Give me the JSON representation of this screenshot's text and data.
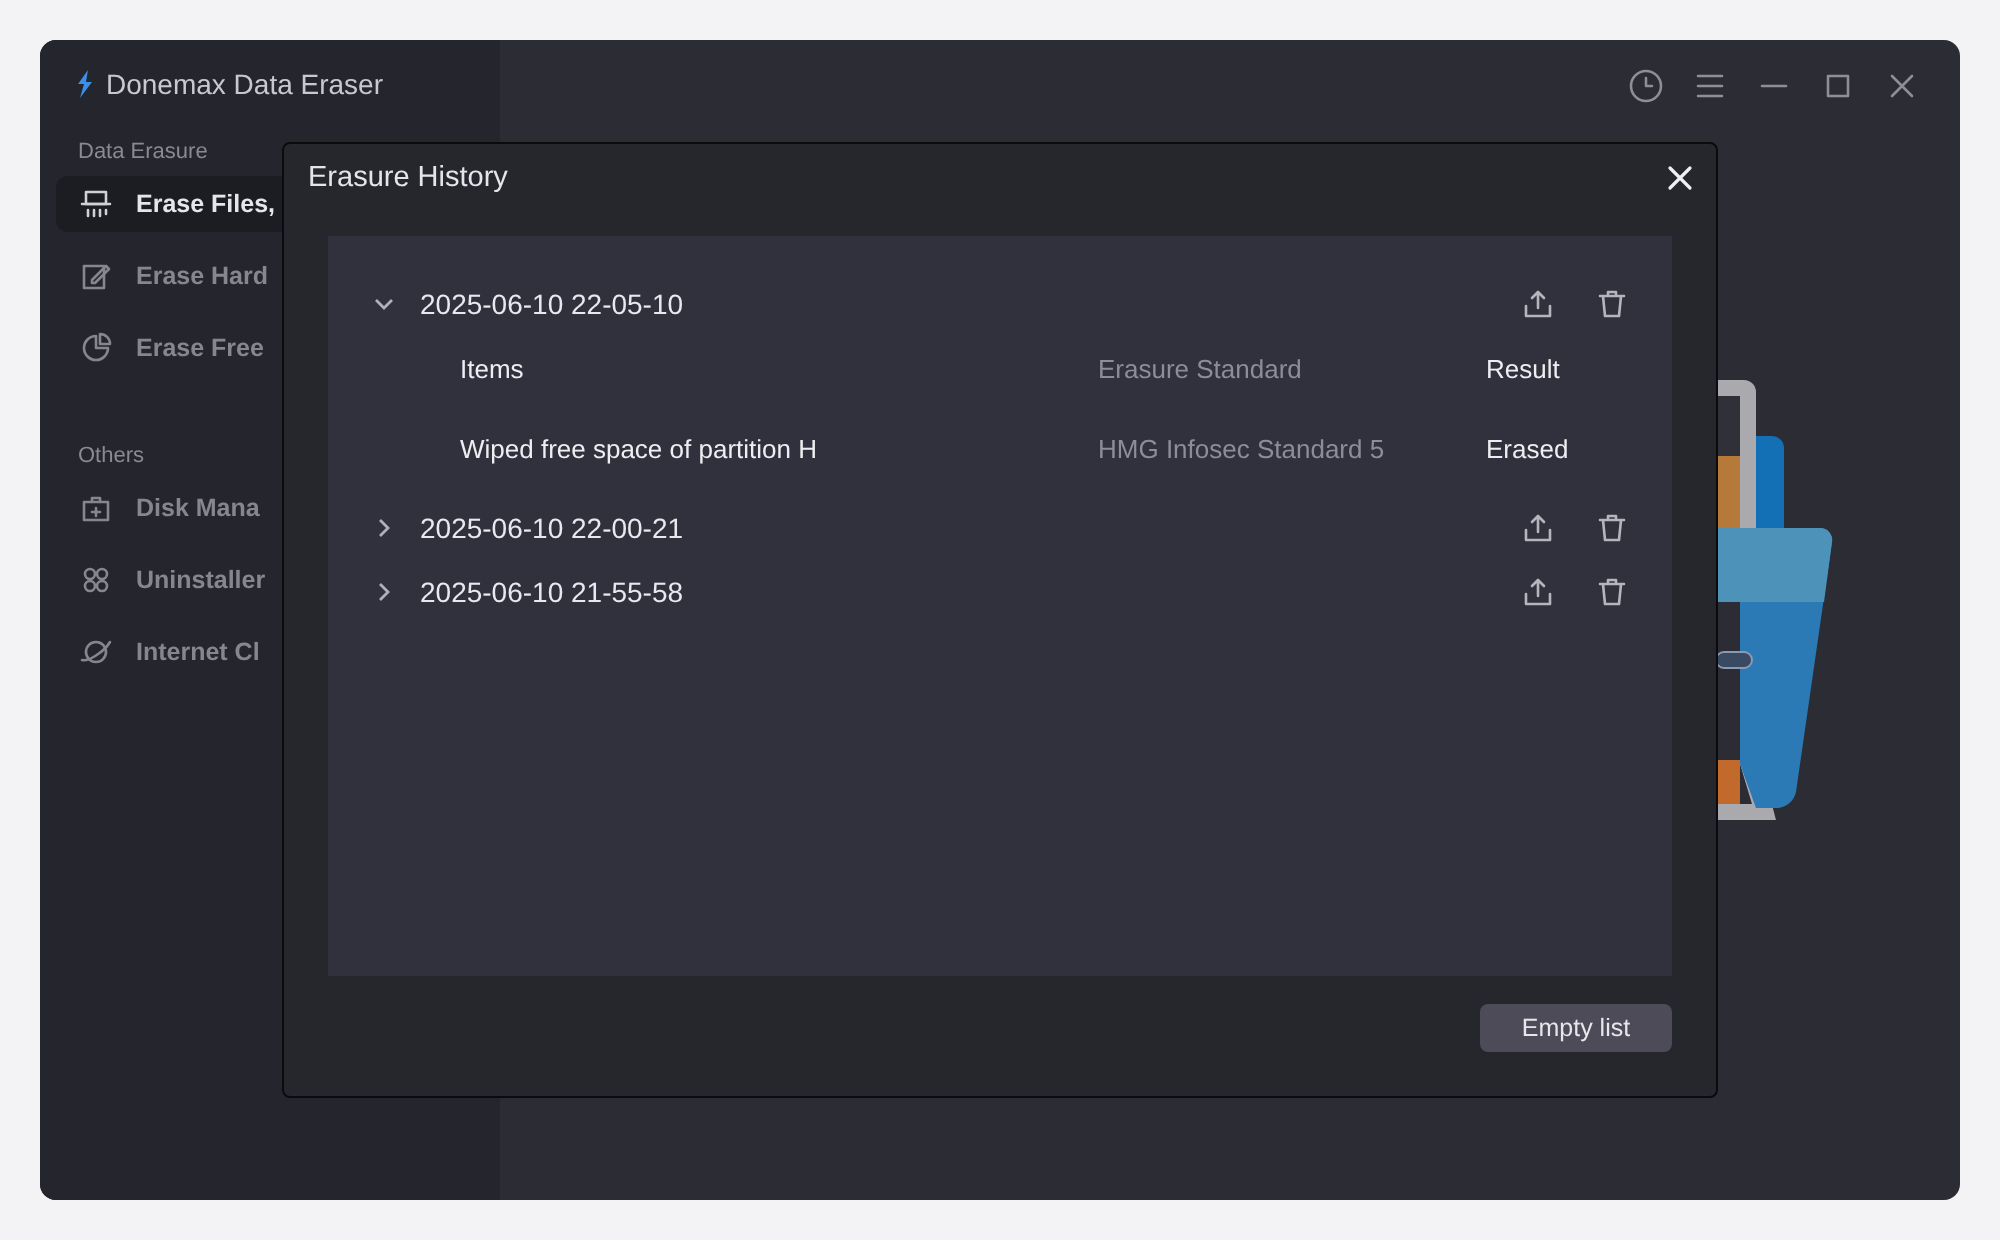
{
  "app": {
    "title": "Donemax Data Eraser"
  },
  "sidebar": {
    "sections": [
      {
        "heading": "Data Erasure",
        "items": [
          {
            "label": "Erase Files,",
            "selected": true
          },
          {
            "label": "Erase Hard",
            "selected": false
          },
          {
            "label": "Erase Free",
            "selected": false
          }
        ]
      },
      {
        "heading": "Others",
        "items": [
          {
            "label": "Disk Mana",
            "selected": false
          },
          {
            "label": "Uninstaller",
            "selected": false
          },
          {
            "label": "Internet Cl",
            "selected": false
          }
        ]
      }
    ]
  },
  "dialog": {
    "title": "Erasure History",
    "entries": [
      {
        "timestamp": "2025-06-10 22-05-10",
        "expanded": true,
        "columns": [
          "Items",
          "Erasure Standard",
          "Result"
        ],
        "rows": [
          [
            "Wiped free space of partition H",
            "HMG Infosec Standard 5",
            "Erased"
          ]
        ]
      },
      {
        "timestamp": "2025-06-10 22-00-21",
        "expanded": false
      },
      {
        "timestamp": "2025-06-10 21-55-58",
        "expanded": false
      }
    ],
    "button": "Empty list"
  }
}
